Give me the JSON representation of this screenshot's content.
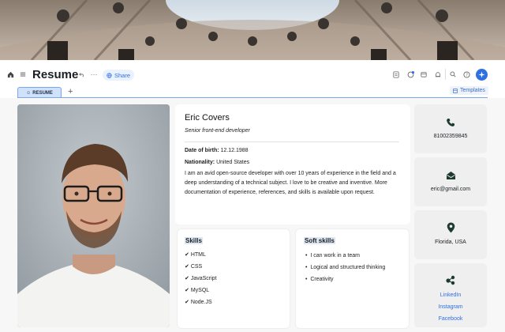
{
  "header": {
    "title": "Resume",
    "share_label": "Share",
    "templates_label": "Templates"
  },
  "tabs": [
    {
      "label": "RESUME",
      "active": true
    }
  ],
  "icons": {
    "home": "home-icon",
    "menu": "menu-icon",
    "undo": "undo-icon",
    "more": "more-icon",
    "tools": [
      "document-icon",
      "comment-icon",
      "calendar-icon",
      "bell-icon",
      "search-icon",
      "help-icon",
      "sparkle-icon"
    ]
  },
  "profile": {
    "name": "Eric Covers",
    "role": "Senior front-end developer",
    "dob_label": "Date of birth:",
    "dob_value": "12.12.1988",
    "nationality_label": "Nationality:",
    "nationality_value": "United States",
    "about": "I am an avid open-source developer with over 10 years of experience in the field and a deep understanding of a technical subject. I love to be creative and inventive. More documentation of experience, references, and skills is available upon request."
  },
  "skills": {
    "title": "Skills",
    "items": [
      "HTML",
      "CSS",
      "JavaScript",
      "MySQL",
      "Node.JS"
    ]
  },
  "soft_skills": {
    "title": "Soft skills",
    "items": [
      "I can work in a team",
      "Logical and structured thinking",
      "Creativity"
    ]
  },
  "contact": {
    "phone": "81002359845",
    "email": "eric@gmail.com",
    "location": "Florida, USA",
    "links": [
      "LinkedIn",
      "Instagram",
      "Facebook"
    ]
  },
  "colors": {
    "accent": "#2f6fe4",
    "tab_bg": "#cfe1fb",
    "contact_bg": "#efefef",
    "icon_dark": "#1e3b2f"
  }
}
